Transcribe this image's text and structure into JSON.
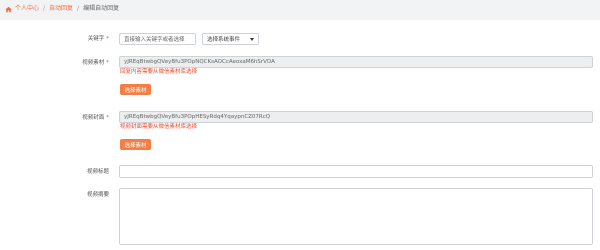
{
  "breadcrumb": {
    "items": [
      "个人中心",
      "自动回复",
      "编辑自动回复"
    ]
  },
  "form": {
    "keyword": {
      "label": "关键字",
      "required_mark": "*",
      "placeholder_button": "直接输入关键字或者选择",
      "select_value": "选择系统事件"
    },
    "video_material": {
      "label": "视频素材",
      "required_mark": "*",
      "value": "yJREqBtwbgQVeyBfu3POpNQCKsAOCcAeoxaM6hSrVDA",
      "hint": "回复内容需要从微信素材库选择",
      "button": "选择素材"
    },
    "video_cover": {
      "label": "视频封面",
      "required_mark": "*",
      "value": "yJREqBtwbgQVeyBfu3POpHESyRdq4YqaypnCZ07RcQ",
      "hint": "视频封面需要从微信素材库选择",
      "button": "选择素材"
    },
    "video_title": {
      "label": "视频标题",
      "value": ""
    },
    "video_summary": {
      "label": "视频摘要",
      "value": ""
    }
  },
  "colors": {
    "accent": "#f47f46",
    "error": "#e9492f",
    "breadcrumb_link": "#f26a3d"
  }
}
